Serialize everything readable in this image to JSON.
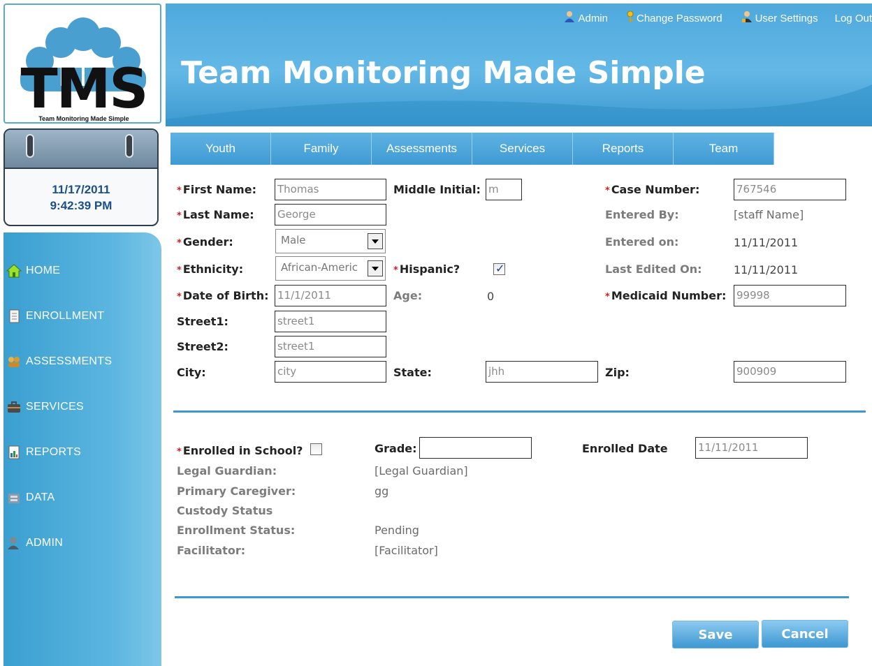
{
  "logo": {
    "text": "TMS",
    "subtitle": "Team Monitoring Made Simple"
  },
  "clock": {
    "date": "11/17/2011",
    "time": "9:42:39 PM"
  },
  "sidebar": {
    "items": [
      {
        "label": "HOME",
        "icon": "home-icon"
      },
      {
        "label": "ENROLLMENT",
        "icon": "document-icon"
      },
      {
        "label": "ASSESSMENTS",
        "icon": "assessment-icon"
      },
      {
        "label": "SERVICES",
        "icon": "briefcase-icon"
      },
      {
        "label": "REPORTS",
        "icon": "report-icon"
      },
      {
        "label": "DATA",
        "icon": "database-icon"
      },
      {
        "label": "ADMIN",
        "icon": "user-icon"
      }
    ]
  },
  "header": {
    "title": "Team Monitoring Made Simple",
    "links": [
      {
        "label": "Admin",
        "icon": "admin-user-icon"
      },
      {
        "label": "Change Password",
        "icon": "key-icon"
      },
      {
        "label": "User Settings",
        "icon": "user-settings-icon"
      },
      {
        "label": "Log Out",
        "icon": ""
      }
    ]
  },
  "tabs": [
    "Youth",
    "Family",
    "Assessments",
    "Services",
    "Reports",
    "Team"
  ],
  "form": {
    "required_mark": "*",
    "first_name": {
      "label": "First Name:",
      "value": "Thomas"
    },
    "middle_initial": {
      "label": "Middle Initial:",
      "value": "m"
    },
    "case_number": {
      "label": "Case Number:",
      "value": "767546"
    },
    "last_name": {
      "label": "Last Name:",
      "value": "George"
    },
    "entered_by": {
      "label": "Entered By:",
      "value": "[staff Name]"
    },
    "gender": {
      "label": "Gender:",
      "value": "Male"
    },
    "entered_on": {
      "label": "Entered on:",
      "value": "11/11/2011"
    },
    "ethnicity": {
      "label": "Ethnicity:",
      "value": "African-Americ"
    },
    "hispanic": {
      "label": "Hispanic?",
      "checked": true
    },
    "last_edited_on": {
      "label": "Last Edited On:",
      "value": "11/11/2011"
    },
    "dob": {
      "label": "Date of Birth:",
      "value": "11/1/2011"
    },
    "age": {
      "label": "Age:",
      "value": "0"
    },
    "medicaid": {
      "label": "Medicaid Number:",
      "value": "99998"
    },
    "street1": {
      "label": "Street1:",
      "value": "street1"
    },
    "street2": {
      "label": "Street2:",
      "value": "street1"
    },
    "city": {
      "label": "City:",
      "value": "city"
    },
    "state": {
      "label": "State:",
      "value": "jhh"
    },
    "zip": {
      "label": "Zip:",
      "value": "900909"
    }
  },
  "enrollment": {
    "enrolled_in_school": {
      "label": "Enrolled in School?",
      "checked": false
    },
    "grade": {
      "label": "Grade:",
      "value": ""
    },
    "enrolled_date": {
      "label": "Enrolled Date",
      "value": "11/11/2011"
    },
    "legal_guardian": {
      "label": "Legal Guardian:",
      "value": "[Legal Guardian]"
    },
    "primary_caregiver": {
      "label": "Primary Caregiver:",
      "value": "gg"
    },
    "custody_status": {
      "label": "Custody Status",
      "value": ""
    },
    "enrollment_status": {
      "label": "Enrollment Status:",
      "value": "Pending"
    },
    "facilitator": {
      "label": "Facilitator:",
      "value": "[Facilitator]"
    }
  },
  "buttons": {
    "save": "Save",
    "cancel": "Cancel"
  },
  "colors": {
    "accent": "#3c98cf",
    "required": "#d21e1e",
    "clock_text": "#1b4f8a"
  }
}
